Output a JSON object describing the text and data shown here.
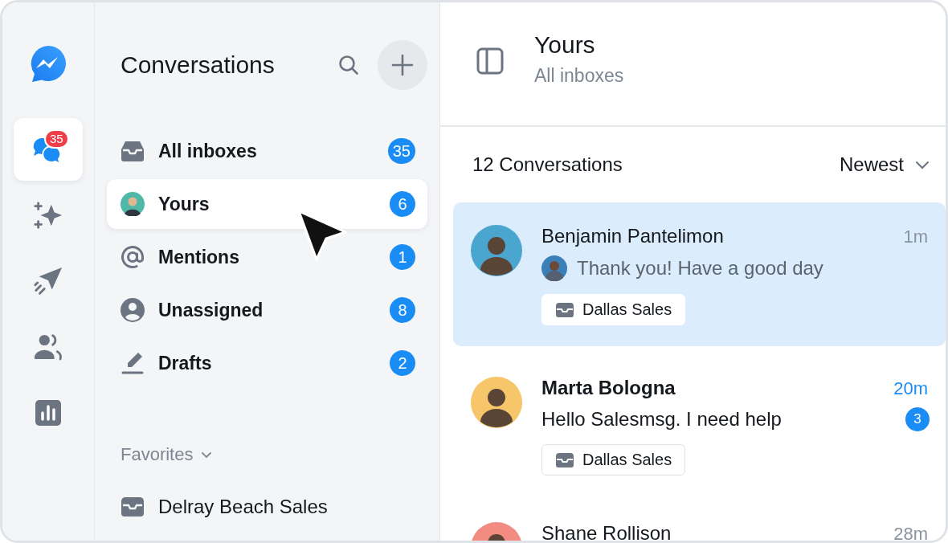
{
  "rail": {
    "items": [
      {
        "kind": "chats",
        "selected": true,
        "badge": "35"
      },
      {
        "kind": "sparkle",
        "selected": false
      },
      {
        "kind": "send",
        "selected": false
      },
      {
        "kind": "contacts",
        "selected": false
      },
      {
        "kind": "reports",
        "selected": false
      }
    ]
  },
  "sidebar": {
    "title": "Conversations",
    "items": [
      {
        "kind": "inbox",
        "label": "All inboxes",
        "count": "35",
        "selected": false
      },
      {
        "kind": "avatar",
        "label": "Yours",
        "count": "6",
        "selected": true
      },
      {
        "kind": "mention",
        "label": "Mentions",
        "count": "1",
        "selected": false
      },
      {
        "kind": "person",
        "label": "Unassigned",
        "count": "8",
        "selected": false
      },
      {
        "kind": "draft",
        "label": "Drafts",
        "count": "2",
        "selected": false
      }
    ],
    "favorites": {
      "label": "Favorites",
      "expanded": true,
      "items": [
        {
          "label": "Delray Beach Sales"
        }
      ]
    }
  },
  "header": {
    "title": "Yours",
    "subtitle": "All inboxes"
  },
  "list": {
    "count_label": "12 Conversations",
    "sort": "Newest",
    "conversations": [
      {
        "name": "Benjamin Pantelimon",
        "time": "1m",
        "preview": "Thank you! Have a good day",
        "reply_avatar": true,
        "inbox": "Dallas Sales",
        "unread": false,
        "selected": true,
        "color": "#4aa6cf"
      },
      {
        "name": "Marta Bologna",
        "time": "20m",
        "preview": "Hello Salesmsg. I need help",
        "count": "3",
        "inbox": "Dallas Sales",
        "unread": true,
        "selected": false,
        "color": "#f7c66b"
      },
      {
        "name": "Shane Rollison",
        "time": "28m",
        "unread": false,
        "selected": false,
        "color": "#f28b82"
      }
    ]
  }
}
